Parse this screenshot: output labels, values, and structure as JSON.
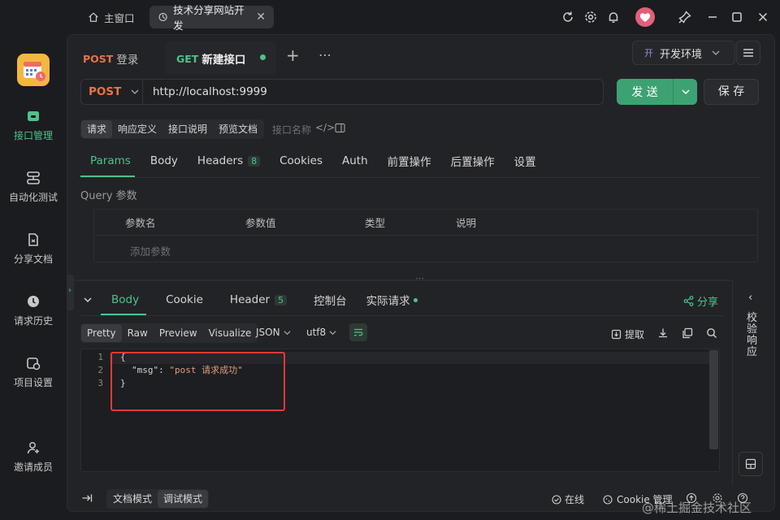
{
  "titlebar": {
    "home_tab": "主窗口",
    "project_tab": "技术分享网站开发"
  },
  "sidebar": {
    "items": [
      {
        "label": "接口管理",
        "active": true
      },
      {
        "label": "自动化测试"
      },
      {
        "label": "分享文档"
      },
      {
        "label": "请求历史"
      },
      {
        "label": "项目设置"
      },
      {
        "label": "邀请成员"
      }
    ]
  },
  "request_tabs": [
    {
      "method": "POST",
      "name": "登录"
    },
    {
      "method": "GET",
      "name": "新建接口",
      "active": true
    }
  ],
  "environment": "开发环境",
  "environment_badge": "开",
  "request": {
    "method": "POST",
    "url": "http://localhost:9999",
    "send_label": "发 送",
    "save_label": "保 存"
  },
  "view_segments": [
    "请求",
    "响应定义",
    "接口说明",
    "预览文档"
  ],
  "api_name_placeholder": "接口名称",
  "param_tabs": [
    {
      "label": "Params",
      "active": true
    },
    {
      "label": "Body"
    },
    {
      "label": "Headers",
      "count": "8"
    },
    {
      "label": "Cookies"
    },
    {
      "label": "Auth"
    },
    {
      "label": "前置操作"
    },
    {
      "label": "后置操作"
    },
    {
      "label": "设置"
    }
  ],
  "query": {
    "title": "Query 参数",
    "columns": [
      "参数名",
      "参数值",
      "类型",
      "说明"
    ],
    "add_placeholder": "添加参数"
  },
  "response_tabs": [
    {
      "label": "Body",
      "active": true
    },
    {
      "label": "Cookie"
    },
    {
      "label": "Header",
      "count": "5"
    },
    {
      "label": "控制台"
    },
    {
      "label": "实际请求"
    }
  ],
  "share_label": "分享",
  "format_segments": [
    "Pretty",
    "Raw",
    "Preview",
    "Visualize"
  ],
  "format_type": "JSON",
  "encoding": "utf8",
  "extract_label": "提取",
  "response_body": {
    "line_numbers": [
      "1",
      "2",
      "3"
    ],
    "line1": "{",
    "key": "\"msg\"",
    "colon": ": ",
    "value": "\"post 请求成功\"",
    "line3": "}"
  },
  "verify_panel": "校验响应",
  "footer": {
    "doc_mode": "文档模式",
    "debug_mode": "调试模式",
    "online": "在线",
    "cookie_mgmt": "Cookie 管理",
    "watermark": "@稀土掘金技术社区"
  },
  "colors": {
    "accent": "#4ec28b",
    "post": "#e8734a",
    "highlight_box": "#e53935"
  }
}
